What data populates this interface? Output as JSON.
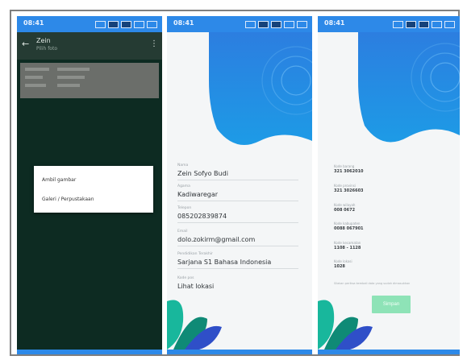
{
  "screens": {
    "one": {
      "status_time": "08:41",
      "app_title": "Zein",
      "app_subtitle": "Pilih foto",
      "dialog_options": [
        "Ambil gambar",
        "Galeri / Perpustakaan"
      ]
    },
    "two": {
      "status_time": "08:41",
      "fields": [
        {
          "label": "Nama",
          "value": "Zein Sofyo Budi"
        },
        {
          "label": "Agama",
          "value": "Kadiwaregar"
        },
        {
          "label": "Telepon",
          "value": "085202839874"
        },
        {
          "label": "Email",
          "value": "dolo.zokirm@gmail.com"
        },
        {
          "label": "Pendidikan Terakhir",
          "value": "Sarjana S1 Bahasa Indonesia"
        },
        {
          "label": "Kode pos",
          "value": "Lihat lokasi"
        }
      ]
    },
    "three": {
      "status_time": "08:41",
      "items": [
        {
          "k": "Kode barang",
          "v": "321 3062010"
        },
        {
          "k": "Kode provinsi",
          "v": "321 3026603"
        },
        {
          "k": "Kode wilayah",
          "v": "008 0672"
        },
        {
          "k": "Kode kabupaten",
          "v": "0088 067901"
        },
        {
          "k": "Kode kecamatan",
          "v": "1108 - 1128"
        },
        {
          "k": "Kode lokasi",
          "v": "1028"
        }
      ],
      "note": "Silakan periksa kembali data yang sudah dimasukkan",
      "button_label": "Simpan"
    }
  },
  "colors": {
    "statusbar": "#2d89e8",
    "dark_bg": "#0d2b22",
    "accent_blue": "#1f6fd6",
    "button_green": "#8ee3b7",
    "leaf_teal": "#18b79c",
    "leaf_blue": "#2f4fc8"
  }
}
